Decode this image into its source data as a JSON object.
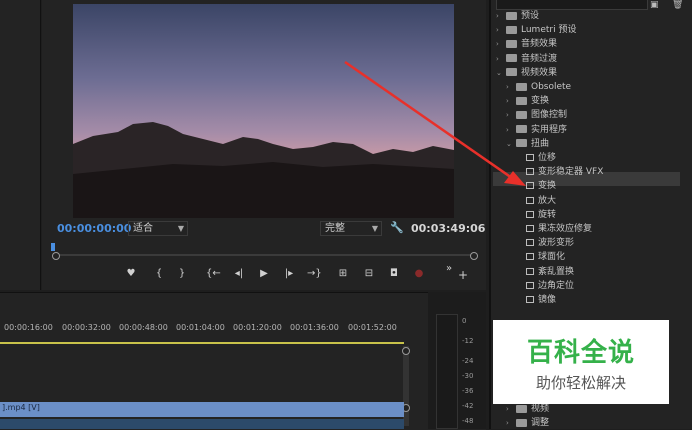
{
  "monitor": {
    "timecode_current": "00:00:00:00",
    "fit_value": "适合",
    "quality_value": "完整",
    "timecode_duration": "00:03:49:06"
  },
  "timeline": {
    "ruler": [
      "00:00:16:00",
      "00:00:32:00",
      "00:00:48:00",
      "00:01:04:00",
      "00:01:20:00",
      "00:01:36:00",
      "00:01:52:00"
    ],
    "clip_label": "].mp4 [V]"
  },
  "meter": {
    "labels": [
      "0",
      "-12",
      "-24",
      "-30",
      "-36",
      "-42",
      "-48"
    ]
  },
  "effects": {
    "items": [
      {
        "label": "预设",
        "kind": "folder",
        "level": 0,
        "open": false
      },
      {
        "label": "Lumetri 预设",
        "kind": "folder",
        "level": 0,
        "open": false
      },
      {
        "label": "音频效果",
        "kind": "folder",
        "level": 0,
        "open": false
      },
      {
        "label": "音频过渡",
        "kind": "folder",
        "level": 0,
        "open": false
      },
      {
        "label": "视频效果",
        "kind": "folder",
        "level": 0,
        "open": true
      },
      {
        "label": "Obsolete",
        "kind": "folder",
        "level": 1,
        "open": false
      },
      {
        "label": "变换",
        "kind": "folder",
        "level": 1,
        "open": false
      },
      {
        "label": "图像控制",
        "kind": "folder",
        "level": 1,
        "open": false
      },
      {
        "label": "实用程序",
        "kind": "folder",
        "level": 1,
        "open": false
      },
      {
        "label": "扭曲",
        "kind": "folder",
        "level": 1,
        "open": true
      },
      {
        "label": "位移",
        "kind": "effect",
        "level": 2
      },
      {
        "label": "变形稳定器 VFX",
        "kind": "effect",
        "level": 2
      },
      {
        "label": "变换",
        "kind": "effect",
        "level": 2
      },
      {
        "label": "放大",
        "kind": "effect",
        "level": 2
      },
      {
        "label": "旋转",
        "kind": "effect",
        "level": 2
      },
      {
        "label": "果冻效应修复",
        "kind": "effect",
        "level": 2
      },
      {
        "label": "波形变形",
        "kind": "effect",
        "level": 2
      },
      {
        "label": "球面化",
        "kind": "effect",
        "level": 2
      },
      {
        "label": "紊乱置换",
        "kind": "effect",
        "level": 2
      },
      {
        "label": "边角定位",
        "kind": "effect",
        "level": 2
      },
      {
        "label": "镜像",
        "kind": "effect",
        "level": 2
      }
    ],
    "bottom_items": [
      {
        "label": "视频",
        "kind": "folder",
        "level": 1
      },
      {
        "label": "调整",
        "kind": "folder",
        "level": 1
      }
    ]
  },
  "watermark": {
    "title": "百科全说",
    "subtitle": "助你轻松解决"
  }
}
